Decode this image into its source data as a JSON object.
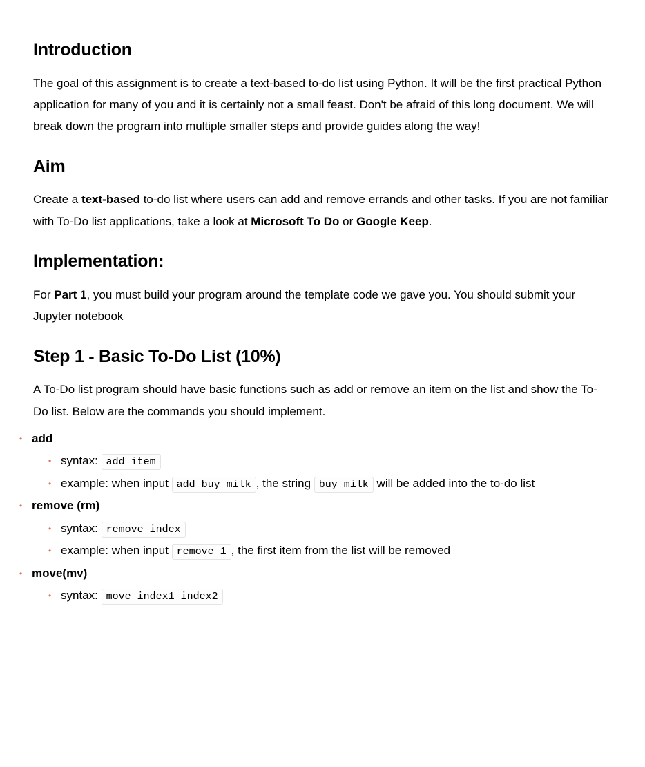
{
  "introduction": {
    "heading": "Introduction",
    "paragraph": "The goal of this assignment is to create a text-based to-do list using Python. It will be the first practical Python application for many of you and it is certainly not a small feast. Don't be afraid of this long document. We will break down the program into multiple smaller steps and provide guides along the way!"
  },
  "aim": {
    "heading": "Aim",
    "p_pre": "Create a ",
    "p_bold1": "text-based",
    "p_mid1": " to-do list where users can add and remove errands and other tasks. If you are not familiar with To-Do list applications, take a look at ",
    "p_bold2": "Microsoft To Do",
    "p_mid2": " or ",
    "p_bold3": "Google Keep",
    "p_post": "."
  },
  "implementation": {
    "heading": "Implementation:",
    "p_pre": "For ",
    "p_bold": "Part 1",
    "p_post": ", you must build your program around the template code we gave you.  You should submit your Jupyter notebook"
  },
  "step1": {
    "heading": "Step 1 - Basic To-Do List (10%)",
    "paragraph": "A To-Do list program should have basic functions such as add or remove an item on the list and show the To-Do list. Below are the commands you should implement.",
    "commands": {
      "add": {
        "label": "add",
        "syntax_label": "syntax: ",
        "syntax_code": "add item",
        "ex_pre": "example: when input ",
        "ex_code1": "add buy milk",
        "ex_mid": ", the string ",
        "ex_code2": "buy milk",
        "ex_post": " will be added into the to-do list"
      },
      "remove": {
        "label": "remove (rm)",
        "syntax_label": "syntax: ",
        "syntax_code": "remove index",
        "ex_pre": "example: when input ",
        "ex_code1": "remove 1",
        "ex_post": ", the first item from the list will be removed"
      },
      "move": {
        "label": "move(mv)",
        "syntax_label": "syntax: ",
        "syntax_code": "move index1 index2"
      }
    }
  }
}
